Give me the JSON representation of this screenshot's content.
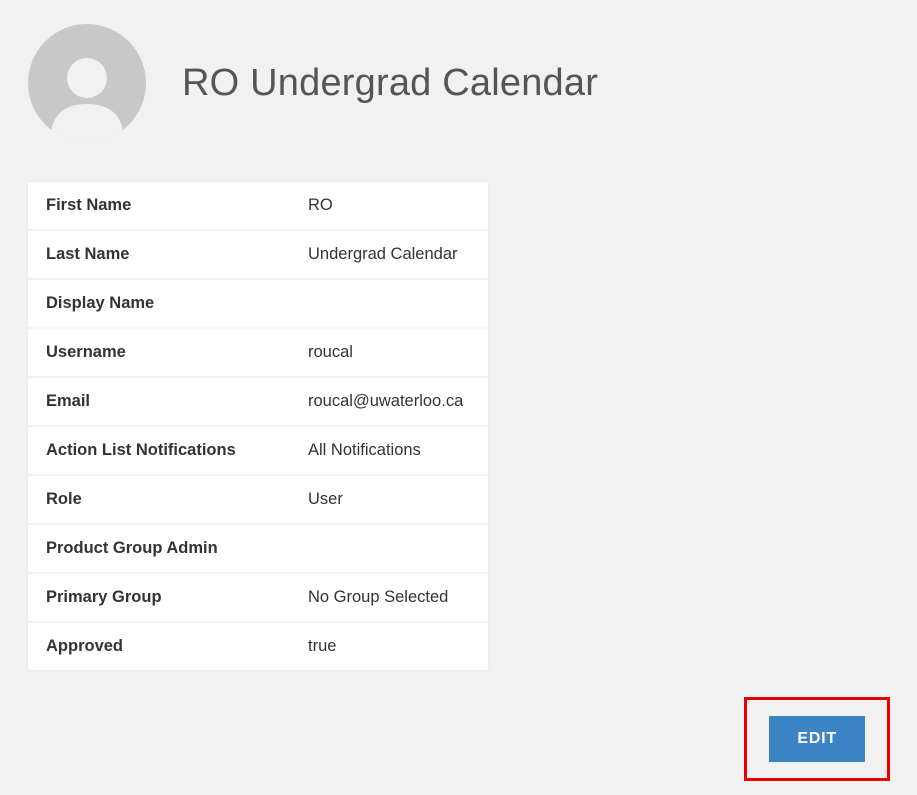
{
  "header": {
    "title": "RO Undergrad Calendar"
  },
  "details": {
    "rows": [
      {
        "label": "First Name",
        "value": "RO"
      },
      {
        "label": "Last Name",
        "value": "Undergrad Calendar"
      },
      {
        "label": "Display Name",
        "value": ""
      },
      {
        "label": "Username",
        "value": "roucal"
      },
      {
        "label": "Email",
        "value": "roucal@uwaterloo.ca"
      },
      {
        "label": "Action List Notifications",
        "value": "All Notifications"
      },
      {
        "label": "Role",
        "value": "User"
      },
      {
        "label": "Product Group Admin",
        "value": ""
      },
      {
        "label": "Primary Group",
        "value": "No Group Selected"
      },
      {
        "label": "Approved",
        "value": "true"
      }
    ]
  },
  "actions": {
    "edit_label": "EDIT"
  },
  "colors": {
    "highlight_border": "#e60000",
    "button_bg": "#3b85c6"
  }
}
